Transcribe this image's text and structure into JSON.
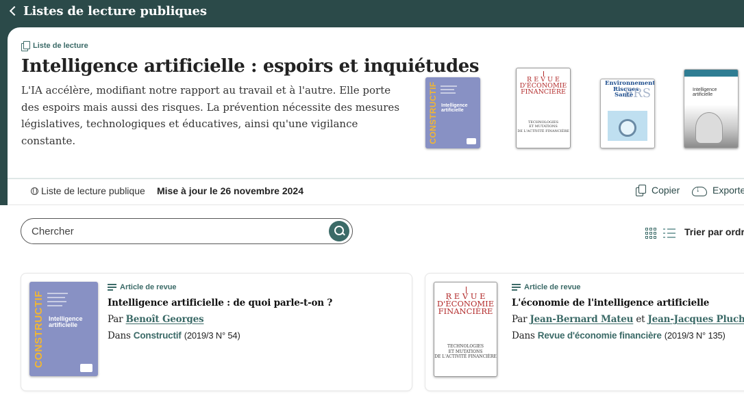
{
  "nav": {
    "back_title": "Listes de lecture publiques"
  },
  "header": {
    "type_label": "Liste de lecture",
    "title": "Intelligence artificielle : espoirs et inquiétudes",
    "description": "L'IA accélère, modifiant notre rapport au travail et à l'autre. Elle porte des espoirs mais aussi des risques. La prévention nécessite des mesures législatives, technologiques et éducatives, ainsi qu'une vigilance constante."
  },
  "covers": {
    "constructif": {
      "band": "CONSTRUCTIF",
      "title": "Intelligence artificielle"
    },
    "ref": {
      "title_lines": [
        "R E V U E",
        "D'ÉCONOMIE",
        "FINANCIÈRE"
      ],
      "subtitle_lines": [
        "TECHNOLOGIES",
        "ET MUTATIONS",
        "DE L'ACTIVITÉ FINANCIÈRE"
      ]
    },
    "ers": {
      "title_lines": [
        "Environnement",
        "Risques",
        "Santé"
      ],
      "big": "ERS"
    },
    "lib": {
      "title": "Intelligence artificielle"
    }
  },
  "meta": {
    "visibility": "Liste de lecture publique",
    "updated": "Mise à jour le 26 novembre 2024",
    "copy_label": "Copier",
    "export_label": "Exporter"
  },
  "search": {
    "placeholder": "Chercher"
  },
  "view": {
    "sort_label": "Trier par ordre"
  },
  "items": [
    {
      "type": "Article de revue",
      "title": "Intelligence artificielle : de quoi parle-t-on ?",
      "by_prefix": "Par",
      "authors": [
        "Benoît Georges"
      ],
      "in_prefix": "Dans",
      "journal": "Constructif",
      "issue": "(2019/3 N° 54)"
    },
    {
      "type": "Article de revue",
      "title": "L'économie de l'intelligence artificielle",
      "by_prefix": "Par",
      "authors": [
        "Jean-Bernard Mateu",
        "Jean-Jacques Pluchart"
      ],
      "and_word": "et",
      "in_prefix": "Dans",
      "journal": "Revue d'économie financière",
      "issue": "(2019/3 N° 135)"
    }
  ],
  "colors": {
    "header_bg": "#2b4a49",
    "accent": "#3b6a67",
    "constructif_cover": "#8891c4",
    "constructif_band": "#f2b632",
    "ref_red": "#b22a2a"
  }
}
